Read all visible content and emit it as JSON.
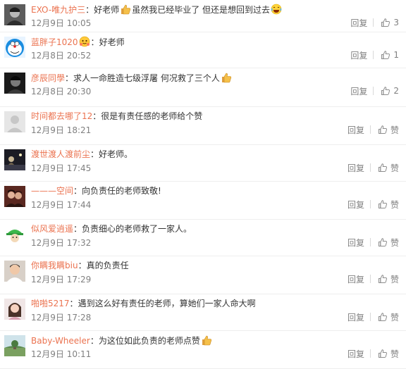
{
  "reply_label": "回复",
  "like_label": "赞",
  "comments": [
    {
      "user": "EXO-唯九护三",
      "sep": "：",
      "parts": [
        "好老师",
        "虽然我已经毕业了 但还是想回到过去",
        ""
      ],
      "emojis": [
        "thumbs-up-emoji",
        "laugh-cry-emoji"
      ],
      "time": "12月9日 10:05",
      "likes": "3",
      "avatar": "gray-portrait"
    },
    {
      "user": "蓝胖子1020",
      "sep": "：",
      "pre_emoji": "hug-emoji",
      "parts": [
        "好老师"
      ],
      "emojis": [],
      "time": "12月8日 20:52",
      "likes": "1",
      "avatar": "doraemon"
    },
    {
      "user": "彦辰同學",
      "sep": "：",
      "parts": [
        "求人一命胜造七级浮屠 何况救了三个人",
        ""
      ],
      "emojis": [
        "thumbs-up-emoji"
      ],
      "time": "12月8日 20:30",
      "likes": "2",
      "avatar": "dark-portrait"
    },
    {
      "user": "时间都去哪了12",
      "sep": "：",
      "parts": [
        "很是有责任感的老师给个赞"
      ],
      "emojis": [],
      "time": "12月9日 18:21",
      "likes": "赞",
      "avatar": "default"
    },
    {
      "user": "渡世渡人渡前尘",
      "sep": "：",
      "parts": [
        "好老师。"
      ],
      "emojis": [],
      "time": "12月9日 17:45",
      "likes": "赞",
      "avatar": "night-scene"
    },
    {
      "user": "———空间",
      "sep": "：",
      "parts": [
        "向负责任的老师致敬!"
      ],
      "emojis": [],
      "time": "12月9日 17:44",
      "likes": "赞",
      "avatar": "couple"
    },
    {
      "user": "似风爱逍遥",
      "sep": "：",
      "parts": [
        "负责细心的老师救了一家人。"
      ],
      "emojis": [],
      "time": "12月9日 17:32",
      "likes": "赞",
      "avatar": "green-hat"
    },
    {
      "user": "你瞒我瞒biu",
      "sep": "：",
      "parts": [
        "真的负责任"
      ],
      "emojis": [],
      "time": "12月9日 17:29",
      "likes": "赞",
      "avatar": "boy-portrait"
    },
    {
      "user": "啪啪5217",
      "sep": "：",
      "parts": [
        "遇到这么好有责任的老师，算她们一家人命大啊"
      ],
      "emojis": [],
      "time": "12月9日 17:28",
      "likes": "赞",
      "avatar": "girl-portrait"
    },
    {
      "user": "Baby-Wheeler",
      "sep": "：",
      "parts": [
        "为这位如此负责的老师点赞",
        ""
      ],
      "emojis": [
        "thumbs-up-emoji"
      ],
      "time": "12月9日 10:11",
      "likes": "赞",
      "avatar": "landscape"
    }
  ],
  "colors": {
    "username": "#eb7350",
    "meta": "#808080",
    "text": "#333333",
    "divider": "#eeeeee"
  }
}
